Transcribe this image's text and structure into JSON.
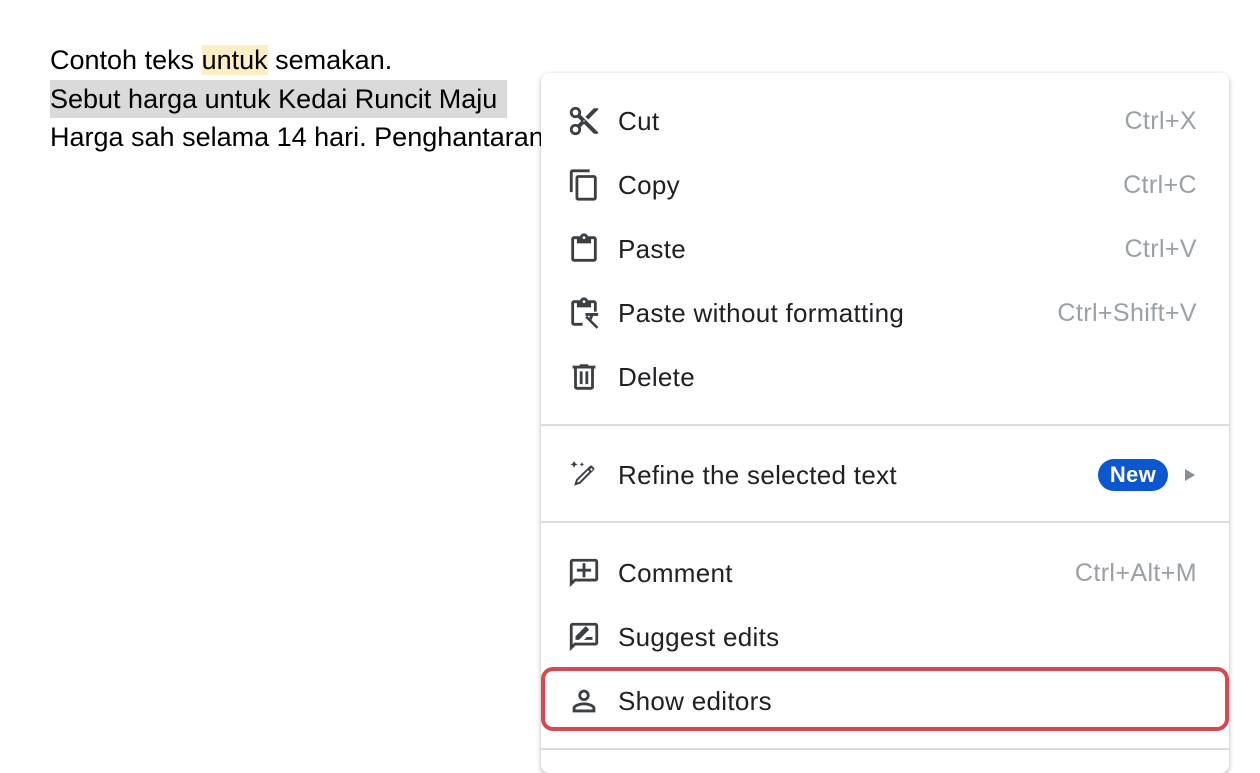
{
  "document": {
    "line1": {
      "before": "Contoh teks ",
      "highlight": "untuk",
      "after": " semakan."
    },
    "line2": "Sebut harga untuk Kedai Runcit Maju",
    "line3": "Harga sah selama 14 hari. Penghantaran"
  },
  "context_menu": {
    "cut": {
      "label": "Cut",
      "shortcut": "Ctrl+X",
      "icon": "scissors-icon"
    },
    "copy": {
      "label": "Copy",
      "shortcut": "Ctrl+C",
      "icon": "copy-icon"
    },
    "paste": {
      "label": "Paste",
      "shortcut": "Ctrl+V",
      "icon": "clipboard-icon"
    },
    "paste_plain": {
      "label": "Paste without formatting",
      "shortcut": "Ctrl+Shift+V",
      "icon": "clipboard-clear-format-icon"
    },
    "delete": {
      "label": "Delete",
      "icon": "trash-icon"
    },
    "refine": {
      "label": "Refine the selected text",
      "badge": "New",
      "icon": "magic-pen-icon"
    },
    "comment": {
      "label": "Comment",
      "shortcut": "Ctrl+Alt+M",
      "icon": "add-comment-icon"
    },
    "suggest": {
      "label": "Suggest edits",
      "icon": "rate-review-icon"
    },
    "show_editors": {
      "label": "Show editors",
      "icon": "person-icon"
    }
  },
  "colors": {
    "selection": "#dadada",
    "highlight": "#fdefc3",
    "badge": "#0b57d0",
    "focus_ring": "#d8484f",
    "shortcut_text": "#9aa0a6"
  }
}
